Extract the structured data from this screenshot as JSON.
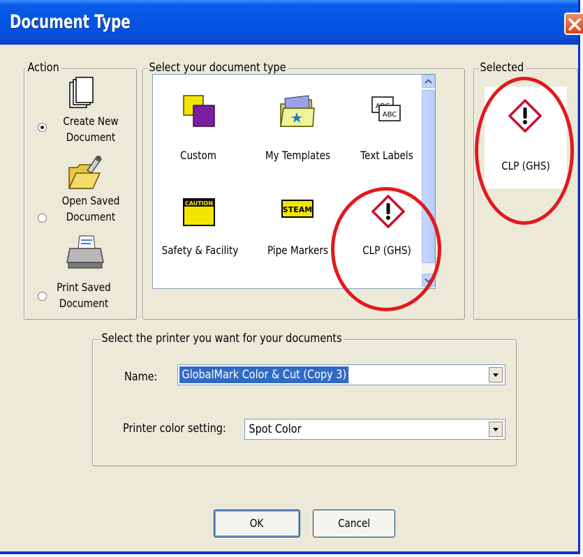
{
  "window": {
    "title": "Document Type"
  },
  "action": {
    "legend": "Action",
    "items": [
      {
        "line1": "Create New",
        "line2": "Document",
        "checked": true,
        "icon": "new-document-icon"
      },
      {
        "line1": "Open Saved",
        "line2": "Document",
        "checked": false,
        "icon": "open-folder-icon"
      },
      {
        "line1": "Print Saved",
        "line2": "Document",
        "checked": false,
        "icon": "printer-icon"
      }
    ]
  },
  "doc_types": {
    "legend": "Select your document type",
    "items": [
      {
        "label": "Custom",
        "icon": "custom-icon"
      },
      {
        "label": "My Templates",
        "icon": "templates-folder-icon"
      },
      {
        "label": "Text Labels",
        "icon": "text-labels-icon",
        "icon_text": "ABC"
      },
      {
        "label": "Safety & Facility",
        "icon": "caution-sign-icon",
        "icon_text": "CAUTION"
      },
      {
        "label": "Pipe Markers",
        "icon": "pipe-marker-icon",
        "icon_text": "STEAM"
      },
      {
        "label": "CLP (GHS)",
        "icon": "ghs-exclamation-icon"
      }
    ]
  },
  "selected": {
    "legend": "Selected",
    "label": "CLP (GHS)",
    "icon": "ghs-exclamation-icon"
  },
  "printer": {
    "legend": "Select the printer you want for your documents",
    "name_label": "Name:",
    "name_value": "GlobalMark Color & Cut (Copy 3)",
    "color_label": "Printer color setting:",
    "color_value": "Spot Color"
  },
  "buttons": {
    "ok": "OK",
    "cancel": "Cancel"
  },
  "colors": {
    "titlebar": "#0454e3",
    "dialog_bg": "#ece9d8",
    "highlight_circle": "#e3181e",
    "ghs_red": "#c8102e",
    "selection": "#316ac5"
  }
}
